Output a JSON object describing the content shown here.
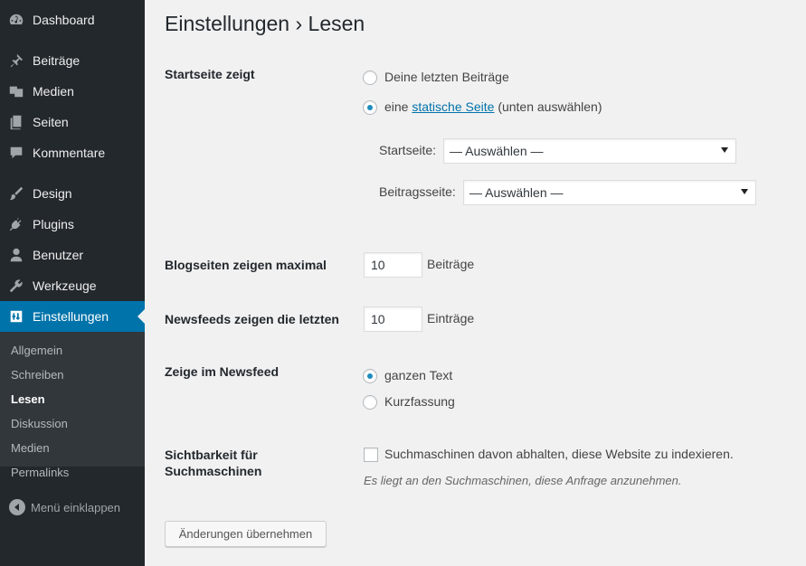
{
  "sidebar": {
    "menu": [
      {
        "label": "Dashboard",
        "icon": "dashboard-icon"
      },
      {
        "label": "Beiträge",
        "icon": "pin-icon"
      },
      {
        "label": "Medien",
        "icon": "media-icon"
      },
      {
        "label": "Seiten",
        "icon": "pages-icon"
      },
      {
        "label": "Kommentare",
        "icon": "comment-icon"
      },
      {
        "label": "Design",
        "icon": "brush-icon"
      },
      {
        "label": "Plugins",
        "icon": "plugin-icon"
      },
      {
        "label": "Benutzer",
        "icon": "user-icon"
      },
      {
        "label": "Werkzeuge",
        "icon": "wrench-icon"
      },
      {
        "label": "Einstellungen",
        "icon": "settings-icon"
      }
    ],
    "submenu": [
      "Allgemein",
      "Schreiben",
      "Lesen",
      "Diskussion",
      "Medien",
      "Permalinks"
    ],
    "collapse_label": "Menü einklappen"
  },
  "page": {
    "title": "Einstellungen › Lesen",
    "front_page": {
      "label": "Startseite zeigt",
      "option_latest": "Deine letzten Beiträge",
      "option_static_prefix": "eine",
      "option_static_link": "statische Seite",
      "option_static_suffix": "(unten auswählen)",
      "selected": "static",
      "front_label": "Startseite:",
      "front_value": "— Auswählen —",
      "posts_label": "Beitragsseite:",
      "posts_value": "— Auswählen —"
    },
    "blog_pages": {
      "label": "Blogseiten zeigen maximal",
      "value": "10",
      "unit": "Beiträge"
    },
    "feeds": {
      "label": "Newsfeeds zeigen die letzten",
      "value": "10",
      "unit": "Einträge"
    },
    "feed_content": {
      "label": "Zeige im Newsfeed",
      "option_full": "ganzen Text",
      "option_summary": "Kurzfassung",
      "selected": "full"
    },
    "visibility": {
      "label_line1": "Sichtbarkeit für",
      "label_line2": "Suchmaschinen",
      "checkbox_label": "Suchmaschinen davon abhalten, diese Website zu indexieren.",
      "checked": false,
      "description": "Es liegt an den Suchmaschinen, diese Anfrage anzunehmen."
    },
    "submit_label": "Änderungen übernehmen"
  },
  "colors": {
    "sidebar_bg": "#23282d",
    "accent": "#0073aa",
    "submenu_bg": "#32373c"
  }
}
